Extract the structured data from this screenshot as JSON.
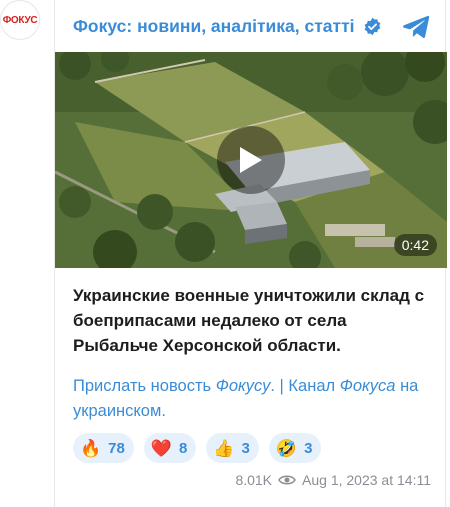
{
  "avatar": {
    "label": "ФОКУС"
  },
  "channel": {
    "name": "Фокус: новини, аналітика, статті"
  },
  "icons": {
    "verified": "verified-icon",
    "telegram": "telegram-icon",
    "play": "play-icon",
    "views": "eye-icon"
  },
  "video": {
    "duration": "0:42"
  },
  "post": {
    "text": "Украинские военные уничтожили склад с боеприпасами недалеко от села Рыбальче Херсонской области.",
    "link1_a": "Прислать новость ",
    "link1_b": "Фокусу",
    "link1_c": ". ",
    "separator": "|",
    "link2_a": " Канал ",
    "link2_b": "Фокуса",
    "link2_c": " на украинском",
    "link2_d": "."
  },
  "reactions": [
    {
      "emoji": "🔥",
      "count": "78"
    },
    {
      "emoji": "❤️",
      "count": "8"
    },
    {
      "emoji": "👍",
      "count": "3"
    },
    {
      "emoji": "🤣",
      "count": "3"
    }
  ],
  "footer": {
    "views": "8.01K",
    "date": "Aug 1, 2023 at 14:11"
  },
  "colors": {
    "accent": "#3a8cd8",
    "reaction_bg": "#e7f1fb",
    "brand_red": "#d81e1e"
  }
}
